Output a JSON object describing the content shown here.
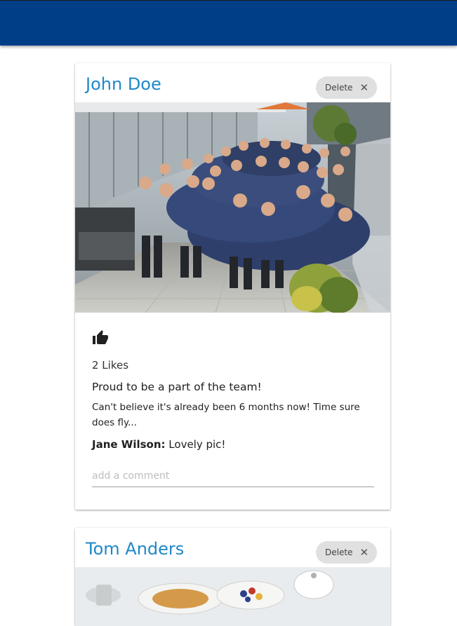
{
  "app": {
    "bar_color": "#003f88",
    "accent": "#1e88c9"
  },
  "posts": [
    {
      "author": "John Doe",
      "delete_label": "Delete",
      "image_alt": "team photo",
      "like_icon": "thumb-up-icon",
      "likes": "2 Likes",
      "title": "Proud to be a part of the team!",
      "body": "Can't believe it's already been 6 months now! Time sure does fly...",
      "comments": [
        {
          "user": "Jane Wilson:",
          "text": " Lovely pic!"
        }
      ],
      "comment_placeholder": "add a comment"
    },
    {
      "author": "Tom Anders",
      "delete_label": "Delete",
      "image_alt": "breakfast photo"
    }
  ]
}
